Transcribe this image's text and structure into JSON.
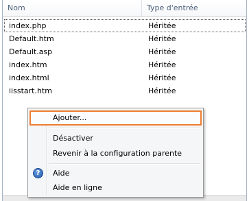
{
  "list": {
    "columns": [
      "Nom",
      "Type d'entrée"
    ],
    "rows": [
      {
        "name": "index.php",
        "type": "Héritée"
      },
      {
        "name": "Default.htm",
        "type": "Héritée"
      },
      {
        "name": "Default.asp",
        "type": "Héritée"
      },
      {
        "name": "index.htm",
        "type": "Héritée"
      },
      {
        "name": "index.html",
        "type": "Héritée"
      },
      {
        "name": "iisstart.htm",
        "type": "Héritée"
      }
    ]
  },
  "context_menu": {
    "items": {
      "add": "Ajouter...",
      "disable": "Désactiver",
      "revert": "Revenir à la configuration parente",
      "help": "Aide",
      "online_help": "Aide en ligne"
    },
    "highlight_color": "#ed7d31",
    "help_icon": "help-icon"
  }
}
